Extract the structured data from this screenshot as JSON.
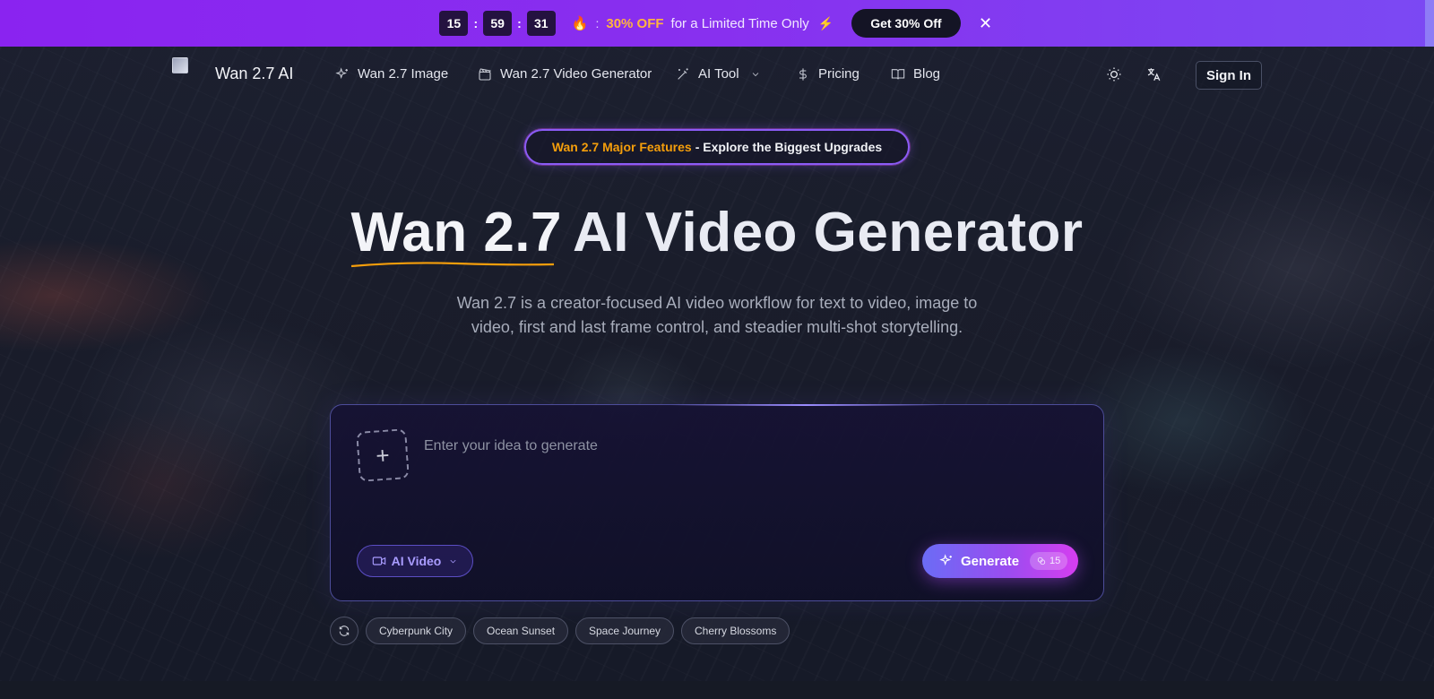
{
  "promo": {
    "timer": {
      "hours": "15",
      "minutes": "59",
      "seconds": "31",
      "separator": ":"
    },
    "fire": "🔥",
    "colon": ":",
    "discount": "30% OFF",
    "text": "for a Limited Time Only",
    "bolt": "⚡",
    "cta_label": "Get 30% Off",
    "close": "✕"
  },
  "nav": {
    "brand": "Wan 2.7 AI",
    "items": [
      {
        "label": "Wan 2.7 Image",
        "icon": "sparkles-icon"
      },
      {
        "label": "Wan 2.7 Video Generator",
        "icon": "clapperboard-icon"
      },
      {
        "label": "AI Tool",
        "icon": "magic-wand-icon"
      },
      {
        "label": "Pricing",
        "icon": "dollar-icon"
      },
      {
        "label": "Blog",
        "icon": "book-icon"
      }
    ],
    "sign_in": "Sign In"
  },
  "feature_pill": {
    "highlight": "Wan 2.7 Major Features",
    "rest": "- Explore the Biggest Upgrades"
  },
  "hero": {
    "title_part1": "Wan 2.7",
    "title_part2": "AI Video Generator",
    "subtitle": "Wan 2.7 is a creator-focused AI video workflow for text to video, image to video, first and last frame control, and steadier multi-shot storytelling."
  },
  "prompt": {
    "placeholder": "Enter your idea to generate",
    "upload_symbol": "+",
    "mode_label": "AI Video",
    "generate_label": "Generate",
    "credits": "15"
  },
  "suggestions": [
    "Cyberpunk City",
    "Ocean Sunset",
    "Space Journey",
    "Cherry Blossoms"
  ],
  "colors": {
    "promo_bg": "#8a23f0",
    "accent_orange": "#f59e0b",
    "accent_purple": "#8b5cf6",
    "generate_gradient_end": "#d63ef0"
  }
}
